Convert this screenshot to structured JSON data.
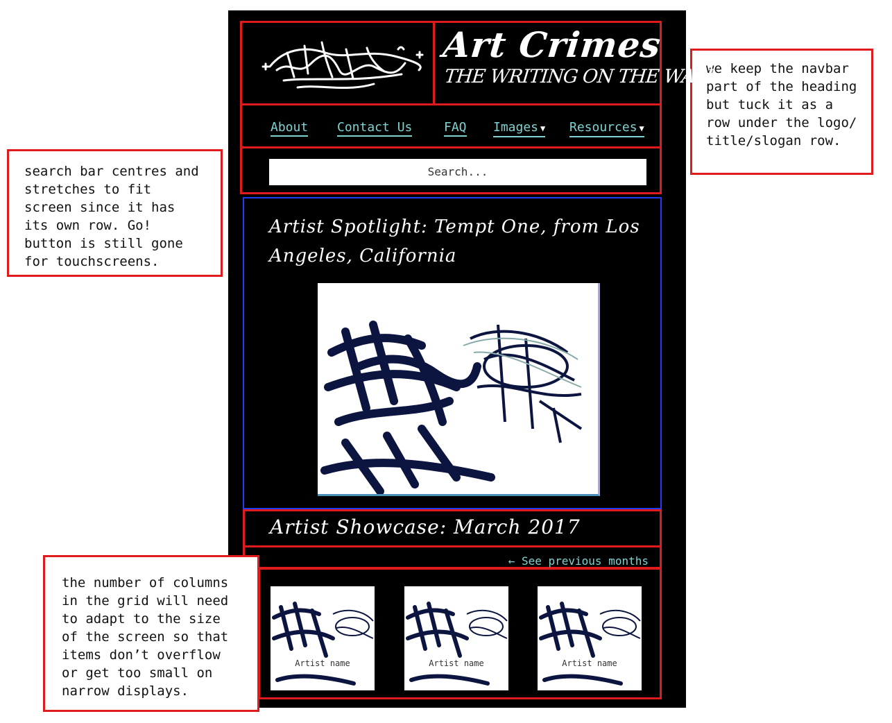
{
  "header": {
    "site_title": "Art Crimes",
    "slogan": "THE WRITING ON THE WALL"
  },
  "nav": {
    "items": [
      {
        "label": "About",
        "has_dropdown": false
      },
      {
        "label": "Contact Us",
        "has_dropdown": false
      },
      {
        "label": "FAQ",
        "has_dropdown": false
      },
      {
        "label": "Images",
        "has_dropdown": true
      },
      {
        "label": "Resources",
        "has_dropdown": true
      }
    ],
    "dropdown_glyph": "▼"
  },
  "search": {
    "placeholder": "Search..."
  },
  "spotlight": {
    "title": "Artist Spotlight: Tempt One, from Los Angeles, California"
  },
  "showcase": {
    "title": "Artist Showcase: March 2017",
    "previous_link": "← See previous months",
    "tiles": [
      {
        "label": "Artist name"
      },
      {
        "label": "Artist name"
      },
      {
        "label": "Artist name"
      }
    ]
  },
  "annotations": {
    "search_note": "search bar centres and stretches to fit screen since it has its own row. Go! button is still gone for touchscreens.",
    "navbar_note": "we keep the navbar part of the heading but tuck it as a row under the logo/ title/slogan row.",
    "grid_note": "the number of columns in the grid will need to adapt to the size of the screen so that items don’t overflow or get too small on narrow displays."
  },
  "colors": {
    "annotation_border": "#e01b1b",
    "spotlight_border": "#1f3cf2",
    "link": "#7fd3d3",
    "background": "#000000"
  }
}
